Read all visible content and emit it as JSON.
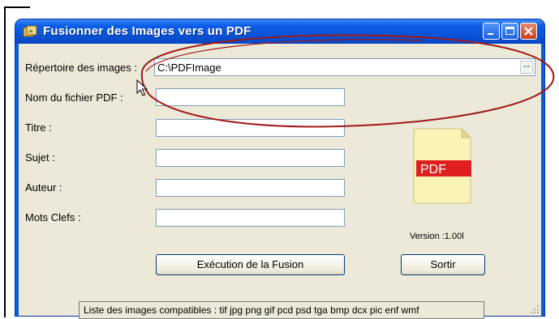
{
  "window": {
    "title": "Fusionner des Images vers un PDF",
    "minimize": "minimize",
    "maximize": "maximize",
    "close": "close"
  },
  "form": {
    "image_dir_label": "Répertoire des images :",
    "image_dir_value": "C:\\PDFImage",
    "browse_label": "...",
    "pdf_name_label": "Nom du fichier PDF :",
    "pdf_name_value": "",
    "title_label": "Titre :",
    "title_value": "",
    "subject_label": "Sujet :",
    "subject_value": "",
    "author_label": "Auteur :",
    "author_value": "",
    "keywords_label": "Mots Clefs :",
    "keywords_value": ""
  },
  "side": {
    "pdf_badge": "PDF",
    "version": "Version :1.00l"
  },
  "buttons": {
    "execute": "Exécution de la Fusion",
    "exit": "Sortir"
  },
  "status": {
    "formats": "Liste des images compatibles : tif jpg png gif pcd psd tga bmp dcx pic enf wmf"
  },
  "colors": {
    "titlebar": "#0a5ede",
    "client": "#ece9d8",
    "annotation": "#a01818",
    "pdf_red": "#e02020"
  }
}
